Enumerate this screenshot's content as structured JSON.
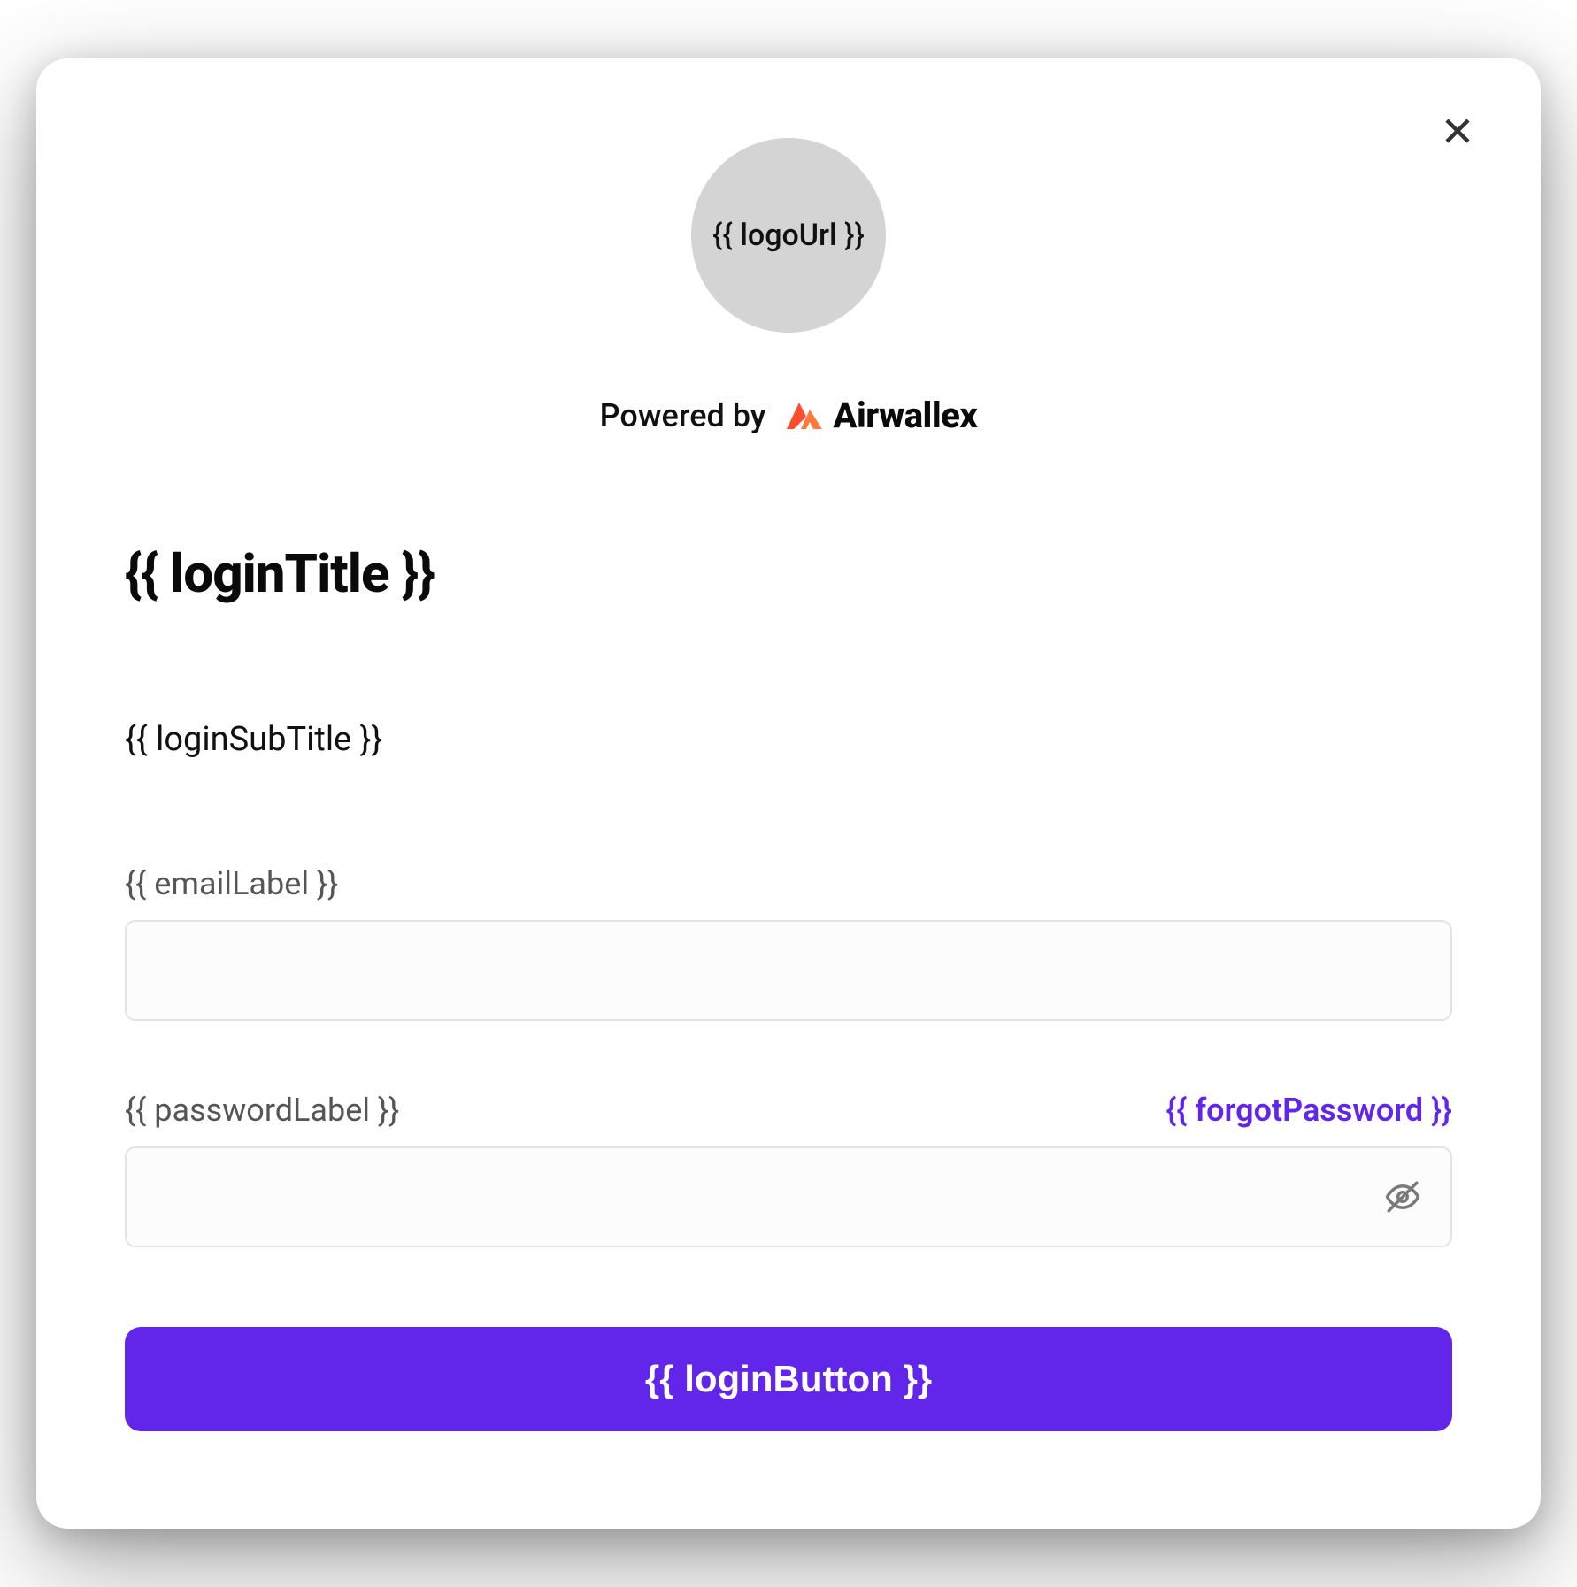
{
  "logo": {
    "placeholder_text": "{{ logoUrl }}"
  },
  "powered_by": {
    "label": "Powered by",
    "brand": "Airwallex"
  },
  "login": {
    "title": "{{ loginTitle }}",
    "subtitle": "{{ loginSubTitle }}"
  },
  "email": {
    "label": "{{ emailLabel }}",
    "value": ""
  },
  "password": {
    "label": "{{ passwordLabel }}",
    "forgot_link": "{{ forgotPassword }}",
    "value": ""
  },
  "login_button": {
    "label": "{{ loginButton }}"
  },
  "colors": {
    "primary": "#6126e9"
  }
}
